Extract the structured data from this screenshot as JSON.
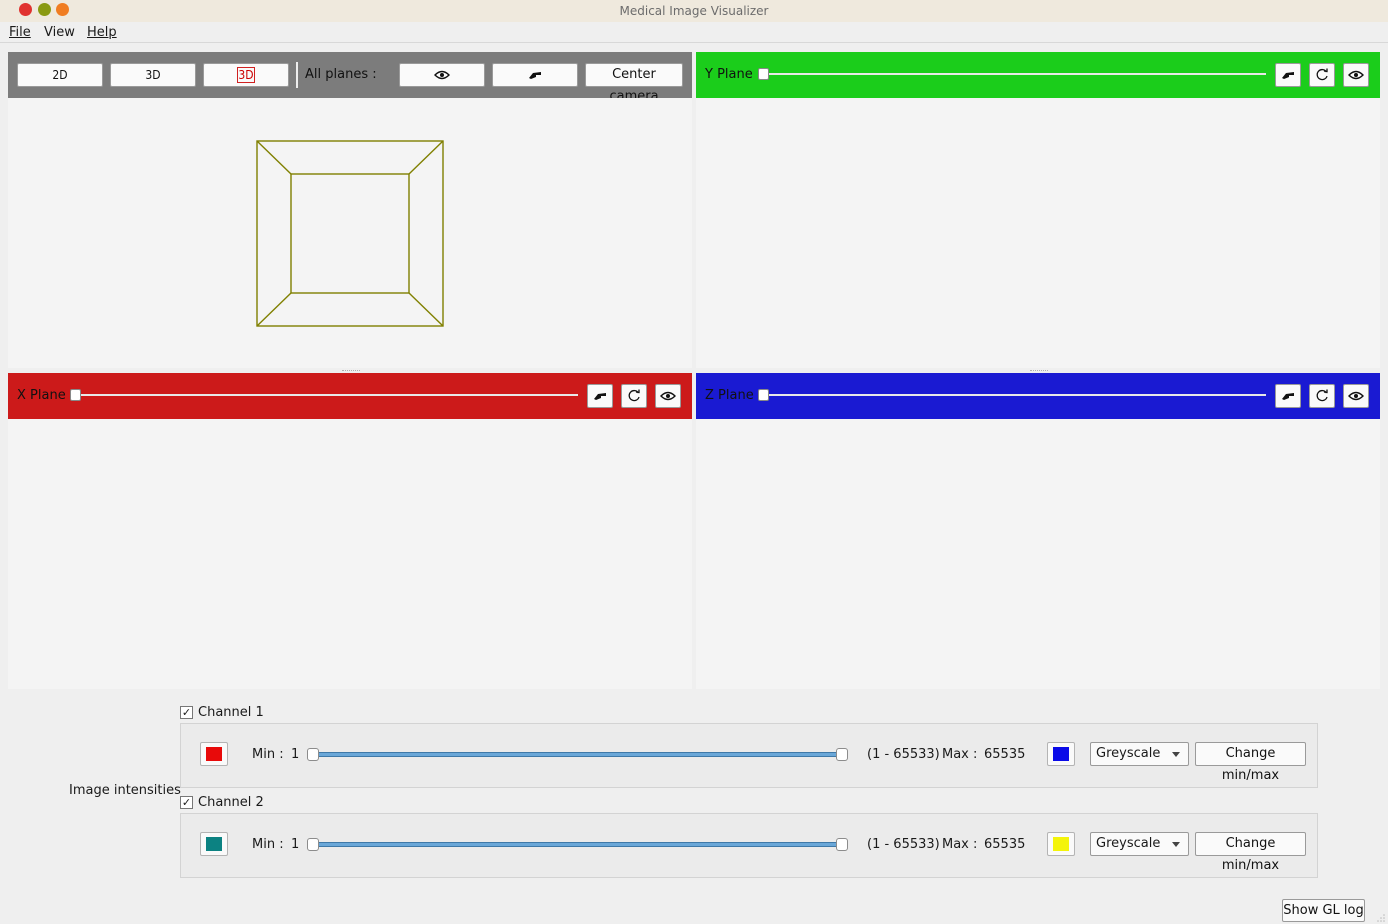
{
  "window": {
    "title": "Medical Image Visualizer"
  },
  "menu": {
    "file": "File",
    "view": "View",
    "help": "Help"
  },
  "view3d": {
    "btn_2d": "2D",
    "btn_3d": "3D",
    "btn_3d_alt": "3D",
    "all_planes_label": "All planes :",
    "center_camera": "Center camera",
    "wireframe_color": "#808000",
    "header_color": "#7c7c7c"
  },
  "planes": {
    "y": {
      "label": "Y Plane",
      "color": "#1bcd1b",
      "value": 0
    },
    "x": {
      "label": "X Plane",
      "color": "#cc1a1a",
      "value": 0
    },
    "z": {
      "label": "Z Plane",
      "color": "#1a1ad2",
      "value": 0
    }
  },
  "intensities": {
    "label": "Image intensities",
    "channels": [
      {
        "name": "Channel 1",
        "checked": true,
        "swatch_left": "#e80a0a",
        "min_label": "Min :",
        "min_value": "1",
        "range_text": "(1 - 65533)",
        "max_label": "Max :",
        "max_value": "65535",
        "swatch_right": "#0a0ae8",
        "colormap": "Greyscale",
        "change_btn": "Change min/max"
      },
      {
        "name": "Channel 2",
        "checked": true,
        "swatch_left": "#0c8282",
        "min_label": "Min :",
        "min_value": "1",
        "range_text": "(1 - 65533)",
        "max_label": "Max :",
        "max_value": "65535",
        "swatch_right": "#f4f40a",
        "colormap": "Greyscale",
        "change_btn": "Change min/max"
      }
    ]
  },
  "footer": {
    "show_gl_log": "Show GL log"
  }
}
